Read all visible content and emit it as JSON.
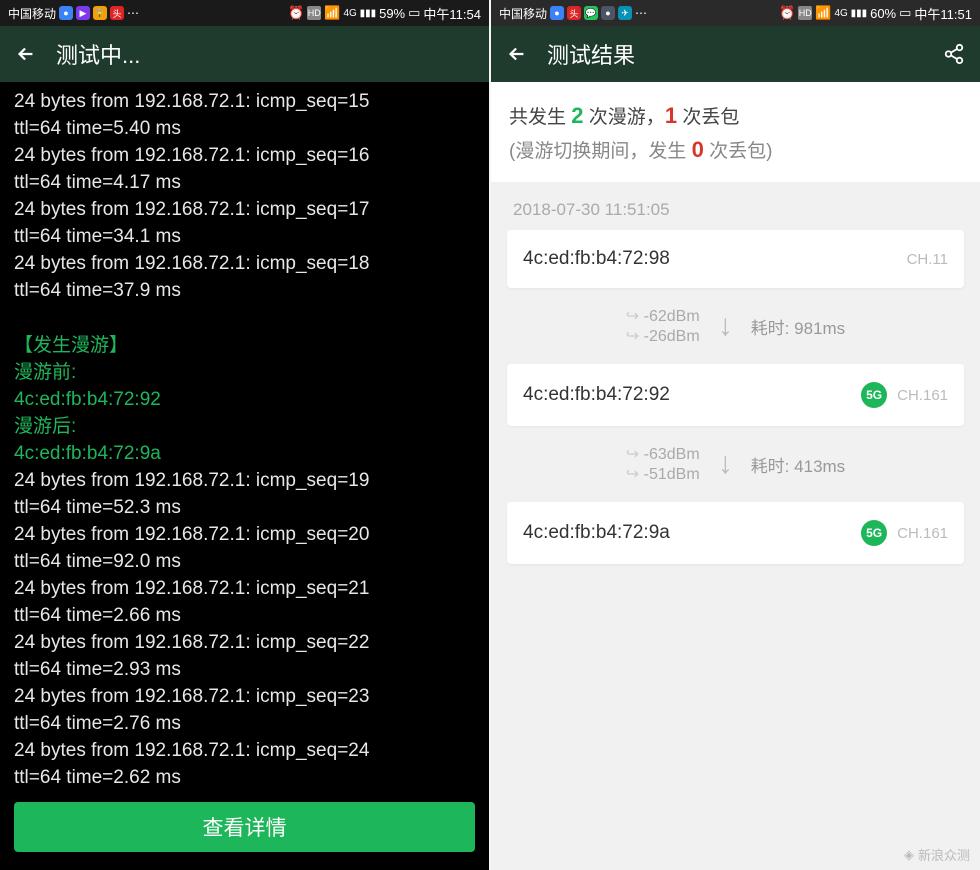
{
  "left": {
    "status": {
      "carrier": "中国移动",
      "battery": "59%",
      "time": "中午11:54"
    },
    "header": {
      "title": "测试中..."
    },
    "ping": [
      {
        "line1": "24 bytes from 192.168.72.1: icmp_seq=15",
        "line2": "ttl=64 time=5.40 ms"
      },
      {
        "line1": "24 bytes from 192.168.72.1: icmp_seq=16",
        "line2": "ttl=64 time=4.17 ms"
      },
      {
        "line1": "24 bytes from 192.168.72.1: icmp_seq=17",
        "line2": "ttl=64 time=34.1 ms"
      },
      {
        "line1": "24 bytes from 192.168.72.1: icmp_seq=18",
        "line2": "ttl=64 time=37.9 ms"
      }
    ],
    "roam": {
      "header": "【发生漫游】",
      "before_label": "漫游前:",
      "before_mac": "4c:ed:fb:b4:72:92",
      "after_label": "漫游后:",
      "after_mac": "4c:ed:fb:b4:72:9a"
    },
    "ping_after": [
      {
        "line1": "24 bytes from 192.168.72.1: icmp_seq=19",
        "line2": "ttl=64 time=52.3 ms"
      },
      {
        "line1": "24 bytes from 192.168.72.1: icmp_seq=20",
        "line2": "ttl=64 time=92.0 ms"
      },
      {
        "line1": "24 bytes from 192.168.72.1: icmp_seq=21",
        "line2": "ttl=64 time=2.66 ms"
      },
      {
        "line1": "24 bytes from 192.168.72.1: icmp_seq=22",
        "line2": "ttl=64 time=2.93 ms"
      },
      {
        "line1": "24 bytes from 192.168.72.1: icmp_seq=23",
        "line2": "ttl=64 time=2.76 ms"
      },
      {
        "line1": "24 bytes from 192.168.72.1: icmp_seq=24",
        "line2": "ttl=64 time=2.62 ms"
      }
    ],
    "details_btn": "查看详情"
  },
  "right": {
    "status": {
      "carrier": "中国移动",
      "battery": "60%",
      "time": "中午11:51"
    },
    "header": {
      "title": "测试结果"
    },
    "summary": {
      "prefix1": "共发生 ",
      "roam_count": "2",
      "mid1": " 次漫游，",
      "loss_count": "1",
      "suffix1": " 次丢包",
      "sub_prefix": "(漫游切换期间，发生 ",
      "sub_count": "0",
      "sub_suffix": " 次丢包)"
    },
    "timestamp": "2018-07-30 11:51:05",
    "hops": [
      {
        "mac": "4c:ed:fb:b4:72:98",
        "band": "",
        "channel": "CH.11"
      },
      {
        "mac": "4c:ed:fb:b4:72:92",
        "band": "5G",
        "channel": "CH.161"
      },
      {
        "mac": "4c:ed:fb:b4:72:9a",
        "band": "5G",
        "channel": "CH.161"
      }
    ],
    "transitions": [
      {
        "from_dbm": "-62dBm",
        "to_dbm": "-26dBm",
        "time_label": "耗时:",
        "time_val": "981ms"
      },
      {
        "from_dbm": "-63dBm",
        "to_dbm": "-51dBm",
        "time_label": "耗时:",
        "time_val": "413ms"
      }
    ],
    "watermark": "新浪众测"
  },
  "icons": {
    "hd": "HD",
    "signal": "▮",
    "alarm": "⏰"
  }
}
